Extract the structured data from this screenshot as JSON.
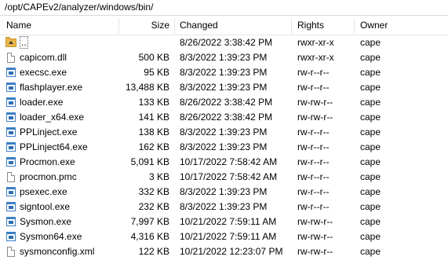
{
  "path": "/opt/CAPEv2/analyzer/windows/bin/",
  "columns": {
    "name": "Name",
    "size": "Size",
    "changed": "Changed",
    "rights": "Rights",
    "owner": "Owner"
  },
  "files": [
    {
      "name": "..",
      "size": "",
      "changed": "8/26/2022 3:38:42 PM",
      "rights": "rwxr-xr-x",
      "owner": "cape",
      "icon": "parent-folder-icon"
    },
    {
      "name": "capicom.dll",
      "size": "500 KB",
      "changed": "8/3/2022 1:39:23 PM",
      "rights": "rwxr-xr-x",
      "owner": "cape",
      "icon": "file-icon"
    },
    {
      "name": "execsc.exe",
      "size": "95 KB",
      "changed": "8/3/2022 1:39:23 PM",
      "rights": "rw-r--r--",
      "owner": "cape",
      "icon": "exe-icon"
    },
    {
      "name": "flashplayer.exe",
      "size": "13,488 KB",
      "changed": "8/3/2022 1:39:23 PM",
      "rights": "rw-r--r--",
      "owner": "cape",
      "icon": "exe-icon"
    },
    {
      "name": "loader.exe",
      "size": "133 KB",
      "changed": "8/26/2022 3:38:42 PM",
      "rights": "rw-rw-r--",
      "owner": "cape",
      "icon": "exe-icon"
    },
    {
      "name": "loader_x64.exe",
      "size": "141 KB",
      "changed": "8/26/2022 3:38:42 PM",
      "rights": "rw-rw-r--",
      "owner": "cape",
      "icon": "exe-icon"
    },
    {
      "name": "PPLinject.exe",
      "size": "138 KB",
      "changed": "8/3/2022 1:39:23 PM",
      "rights": "rw-r--r--",
      "owner": "cape",
      "icon": "exe-icon"
    },
    {
      "name": "PPLinject64.exe",
      "size": "162 KB",
      "changed": "8/3/2022 1:39:23 PM",
      "rights": "rw-r--r--",
      "owner": "cape",
      "icon": "exe-icon"
    },
    {
      "name": "Procmon.exe",
      "size": "5,091 KB",
      "changed": "10/17/2022 7:58:42 AM",
      "rights": "rw-r--r--",
      "owner": "cape",
      "icon": "exe-icon"
    },
    {
      "name": "procmon.pmc",
      "size": "3 KB",
      "changed": "10/17/2022 7:58:42 AM",
      "rights": "rw-r--r--",
      "owner": "cape",
      "icon": "file-icon"
    },
    {
      "name": "psexec.exe",
      "size": "332 KB",
      "changed": "8/3/2022 1:39:23 PM",
      "rights": "rw-r--r--",
      "owner": "cape",
      "icon": "exe-icon"
    },
    {
      "name": "signtool.exe",
      "size": "232 KB",
      "changed": "8/3/2022 1:39:23 PM",
      "rights": "rw-r--r--",
      "owner": "cape",
      "icon": "exe-icon"
    },
    {
      "name": "Sysmon.exe",
      "size": "7,997 KB",
      "changed": "10/21/2022 7:59:11 AM",
      "rights": "rw-rw-r--",
      "owner": "cape",
      "icon": "exe-icon"
    },
    {
      "name": "Sysmon64.exe",
      "size": "4,316 KB",
      "changed": "10/21/2022 7:59:11 AM",
      "rights": "rw-rw-r--",
      "owner": "cape",
      "icon": "exe-icon"
    },
    {
      "name": "sysmonconfig.xml",
      "size": "122 KB",
      "changed": "10/21/2022 12:23:07 PM",
      "rights": "rw-rw-r--",
      "owner": "cape",
      "icon": "file-icon"
    }
  ]
}
